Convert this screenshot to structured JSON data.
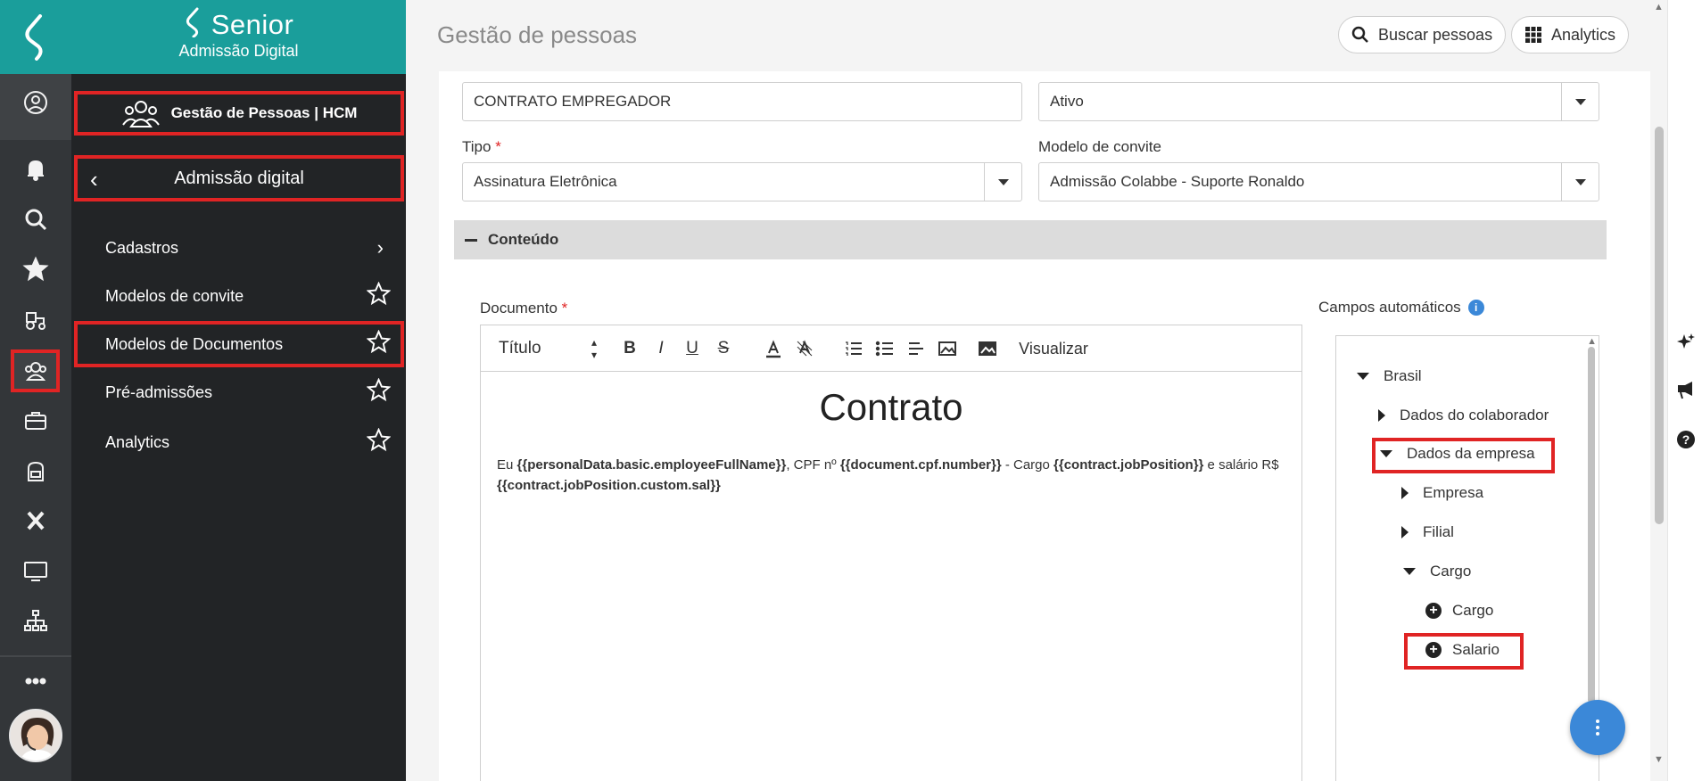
{
  "brand": {
    "name": "Senior",
    "subtitle": "Admissão Digital"
  },
  "side_menu": {
    "module": "Gestão de Pessoas | HCM",
    "section": "Admissão digital",
    "items": [
      {
        "label": "Cadastros",
        "type": "submenu"
      },
      {
        "label": "Modelos de convite",
        "type": "favorite"
      },
      {
        "label": "Modelos de Documentos",
        "type": "favorite"
      },
      {
        "label": "Pré-admissões",
        "type": "favorite"
      },
      {
        "label": "Analytics",
        "type": "favorite"
      }
    ]
  },
  "rail_icons": [
    "profile-icon",
    "bell-icon",
    "search-icon",
    "star-icon",
    "tractor-icon",
    "people-hcm-icon",
    "briefcase-icon",
    "backpack-icon",
    "x-icon",
    "monitor-icon",
    "org-chart-icon",
    "more-icon"
  ],
  "header": {
    "title": "Gestão de pessoas",
    "search_button": "Buscar pessoas",
    "analytics_button": "Analytics"
  },
  "form": {
    "name_value": "CONTRATO EMPREGADOR",
    "status_value": "Ativo",
    "tipo_label": "Tipo",
    "tipo_value": "Assinatura Eletrônica",
    "modelo_label": "Modelo de convite",
    "modelo_value": "Admissão Colabbe - Suporte Ronaldo",
    "required_mark": "*"
  },
  "content_section": {
    "title": "Conteúdo"
  },
  "editor": {
    "label": "Documento",
    "toolbar": {
      "heading_select": "Título",
      "buttons": [
        "B",
        "I",
        "U",
        "S"
      ],
      "preview": "Visualizar"
    },
    "doc_title": "Contrato",
    "body": {
      "t1": "Eu ",
      "v1": "{{personalData.basic.employeeFullName}}",
      "t2": ", CPF nº ",
      "v2": "{{document.cpf.number}}",
      "t3": "  - Cargo ",
      "v3": "{{contract.jobPosition}}",
      "t4": " e salário R$ ",
      "v4": "{{contract.jobPosition.custom.sal}}"
    }
  },
  "auto_fields": {
    "label": "Campos automáticos",
    "info": "i",
    "tree": [
      {
        "label": "Brasil",
        "level": 0,
        "state": "expanded"
      },
      {
        "label": "Dados do colaborador",
        "level": 1,
        "state": "collapsed"
      },
      {
        "label": "Dados da empresa",
        "level": 1,
        "state": "expanded",
        "highlighted": true
      },
      {
        "label": "Empresa",
        "level": 2,
        "state": "collapsed"
      },
      {
        "label": "Filial",
        "level": 2,
        "state": "collapsed"
      },
      {
        "label": "Cargo",
        "level": 2,
        "state": "expanded"
      },
      {
        "label": "Cargo",
        "level": 3,
        "state": "leaf"
      },
      {
        "label": "Salario",
        "level": 3,
        "state": "leaf",
        "highlighted": true
      }
    ]
  },
  "colors": {
    "teal": "#1a9e9b",
    "highlight": "#e02424",
    "accent": "#3b88d8",
    "sidebar": "#222426"
  }
}
